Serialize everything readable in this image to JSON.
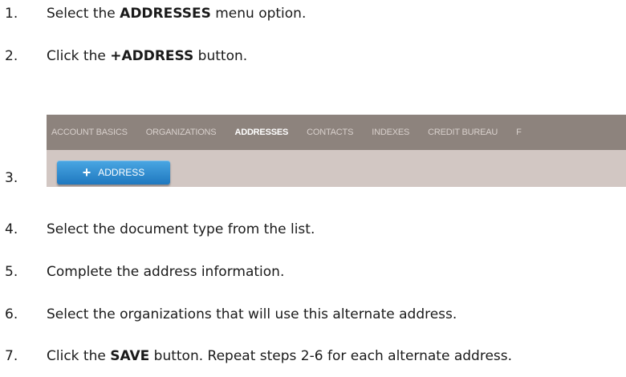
{
  "steps": [
    {
      "num": "1.",
      "pre": "Select the ",
      "bold": "ADDRESSES",
      "post": " menu option."
    },
    {
      "num": "2.",
      "pre": "Click the ",
      "bold": "+ADDRESS",
      "post": " button."
    },
    {
      "num": "3."
    },
    {
      "num": "4.",
      "text": "Select the document type from the list."
    },
    {
      "num": "5.",
      "text": "Complete the address information."
    },
    {
      "num": "6.",
      "text": "Select the organizations that will use this alternate address."
    },
    {
      "num": "7.",
      "pre": "Click the ",
      "bold": "SAVE",
      "post": " button. Repeat steps 2-6 for each alternate address."
    }
  ],
  "screenshot": {
    "menu": [
      {
        "label": "ACCOUNT BASICS",
        "active": false
      },
      {
        "label": "ORGANIZATIONS",
        "active": false
      },
      {
        "label": "ADDRESSES",
        "active": true
      },
      {
        "label": "CONTACTS",
        "active": false
      },
      {
        "label": "INDEXES",
        "active": false
      },
      {
        "label": "CREDIT BUREAU",
        "active": false
      },
      {
        "label": "F",
        "active": false
      }
    ],
    "button_plus": "+",
    "button_label": "ADDRESS"
  }
}
